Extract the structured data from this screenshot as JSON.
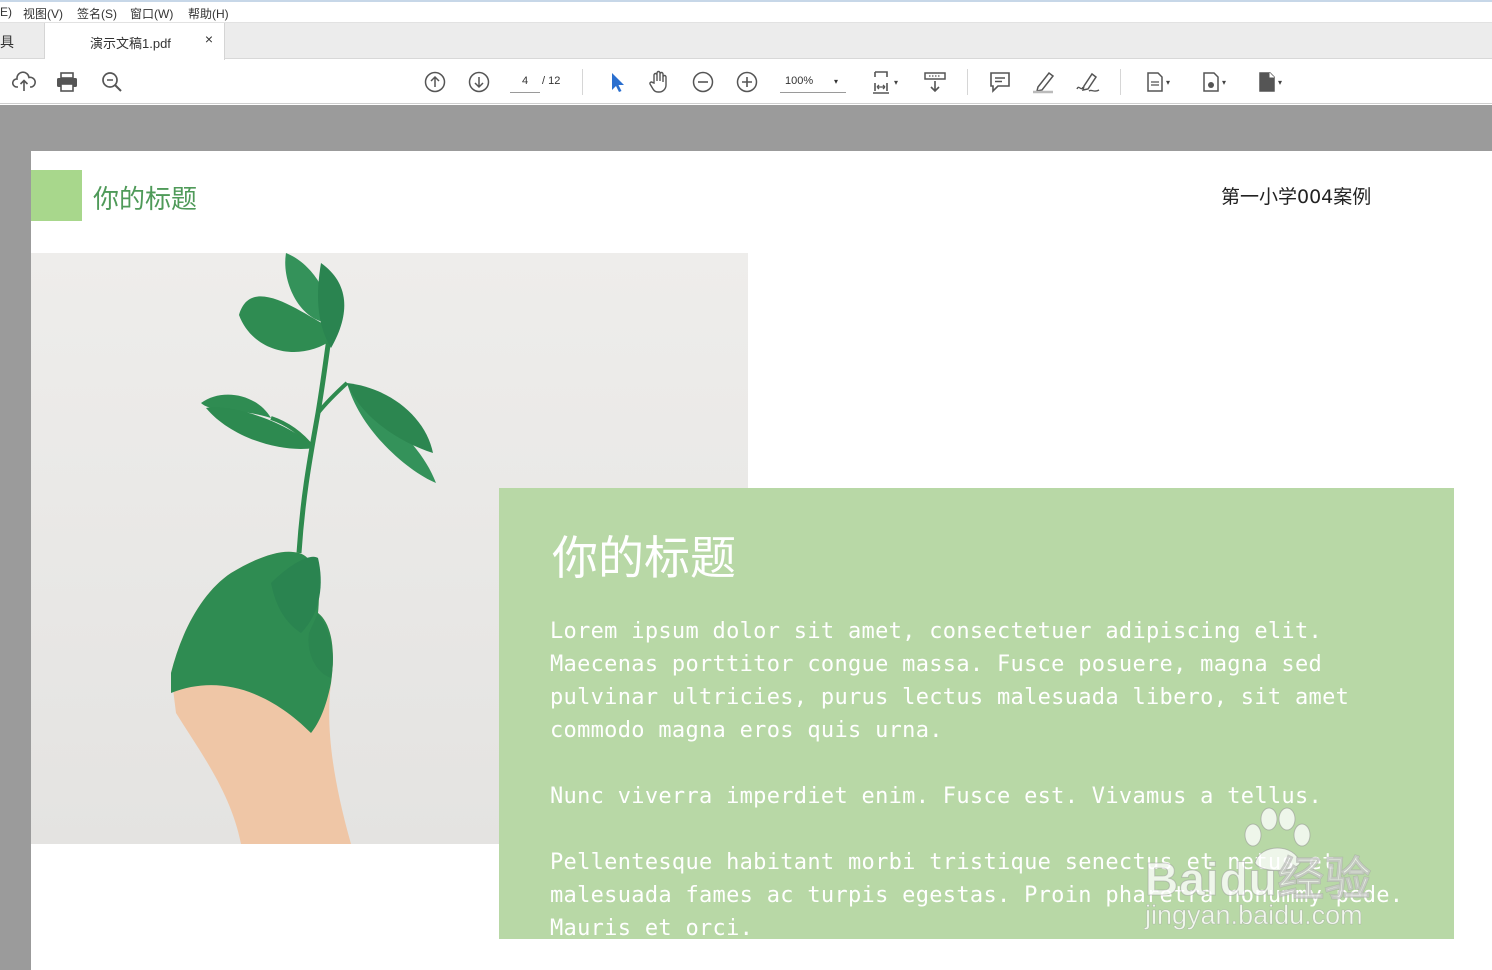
{
  "menu": {
    "items": [
      {
        "label": "E)"
      },
      {
        "label": "视图(V)"
      },
      {
        "label": "签名(S)"
      },
      {
        "label": "窗口(W)"
      },
      {
        "label": "帮助(H)"
      }
    ]
  },
  "tabs": {
    "tools_label": "具",
    "document_tab": {
      "label": "演示文稿1.pdf",
      "close": "×"
    }
  },
  "toolbar": {
    "icons": [
      "upload-icon",
      "print-icon",
      "search-zoom-icon",
      "arrow-up-icon",
      "arrow-down-icon",
      "select-arrow-icon",
      "hand-icon",
      "zoom-out-icon",
      "zoom-in-icon",
      "fit-page-icon",
      "scroll-mode-icon",
      "comment-icon",
      "highlight-icon",
      "sign-icon",
      "page-tool-icon",
      "export-icon",
      "more-doc-icon"
    ],
    "current_page": "4",
    "total_pages": "/ 12",
    "zoom": "100%",
    "dropdown_glyph": "▾",
    "accent_color": "#2a6fcf"
  },
  "slide": {
    "header_title": "你的标题",
    "header_right": "第一小学004案例",
    "accent_color": "#a8d78c",
    "box_color": "#b8d8a6",
    "box_title": "你的标题",
    "paragraph1": "Lorem ipsum dolor sit amet, consectetuer adipiscing elit. Maecenas porttitor congue massa. Fusce posuere, magna sed pulvinar ultricies, purus lectus malesuada libero, sit amet commodo magna eros quis urna.",
    "paragraph2": "Nunc viverra imperdiet enim. Fusce est. Vivamus a tellus.",
    "paragraph3": "Pellentesque habitant morbi tristique senectus et netus et malesuada fames ac turpis egestas. Proin pharetra nonummy pede. Mauris et orci."
  },
  "watermark": {
    "brand": "Baidu经验",
    "url": "jingyan.baidu.com"
  }
}
